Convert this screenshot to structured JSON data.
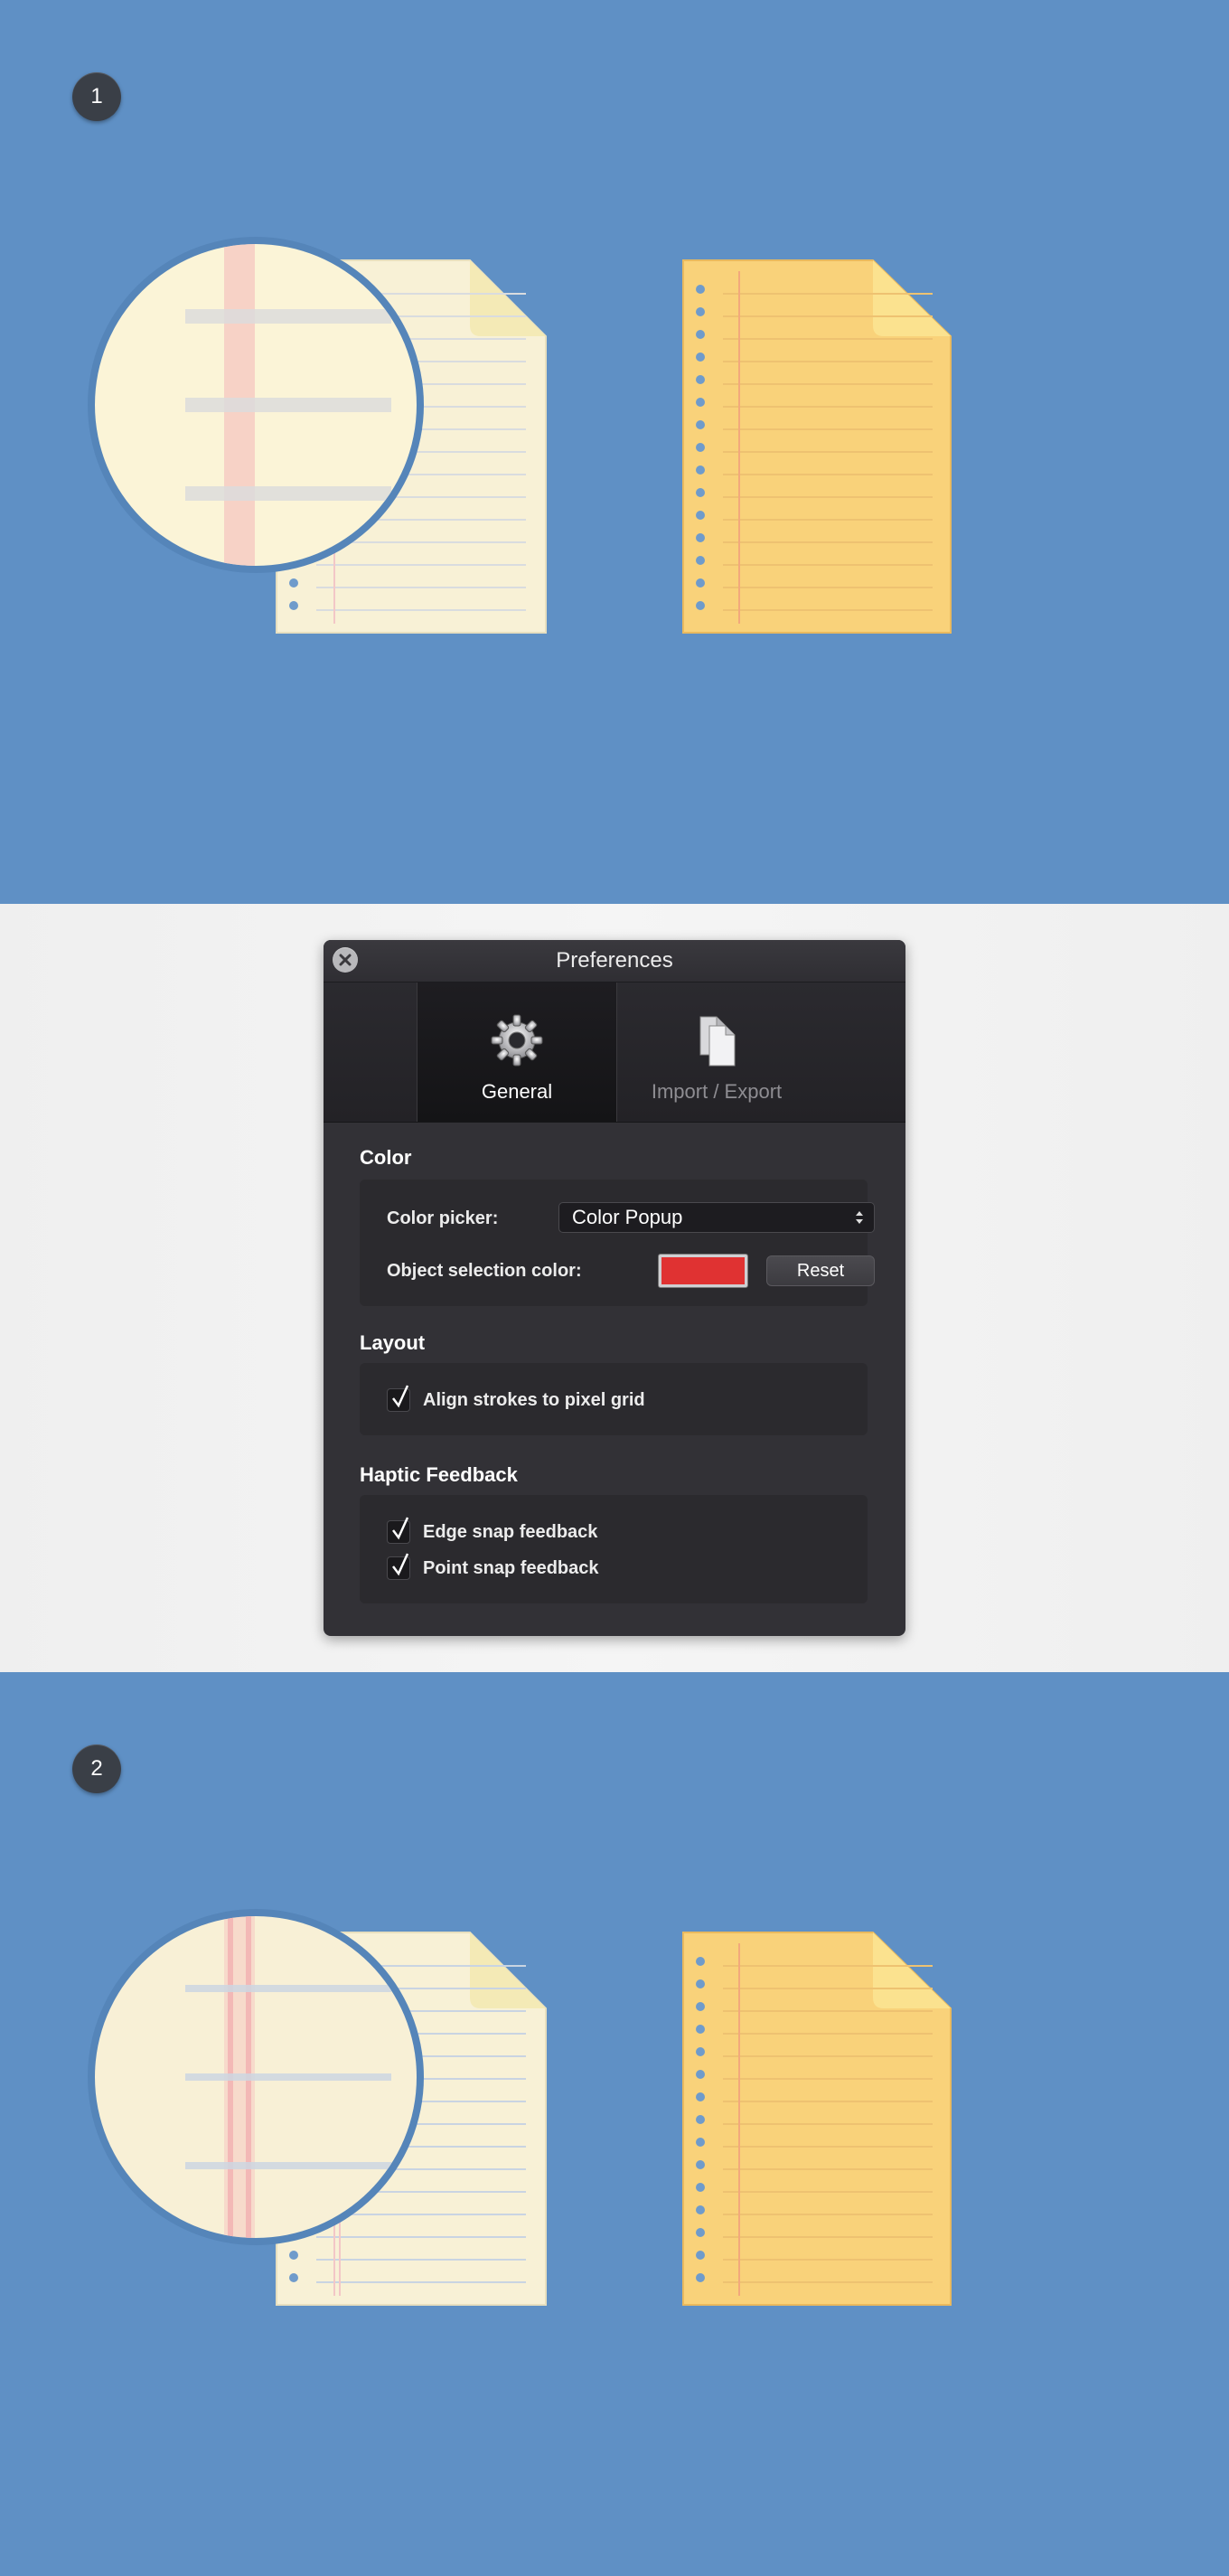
{
  "steps": [
    "1",
    "2"
  ],
  "dialog": {
    "title": "Preferences",
    "tabs": [
      {
        "label": "General",
        "icon": "gear-icon",
        "selected": true
      },
      {
        "label": "Import / Export",
        "icon": "documents-icon",
        "selected": false
      }
    ],
    "sections": {
      "color": {
        "title": "Color",
        "color_picker_label": "Color picker:",
        "color_picker_value": "Color Popup",
        "selection_color_label": "Object selection color:",
        "selection_color": "#e03232",
        "reset_label": "Reset"
      },
      "layout": {
        "title": "Layout",
        "align_strokes_label": "Align strokes to pixel grid",
        "align_strokes_checked": true
      },
      "haptic": {
        "title": "Haptic Feedback",
        "edge_snap_label": "Edge snap feedback",
        "edge_snap_checked": true,
        "point_snap_label": "Point snap feedback",
        "point_snap_checked": true
      }
    }
  },
  "colors": {
    "background_blue": "#5f90c5",
    "paper_cream": "#f8f1d6",
    "paper_yellow": "#f9d27a",
    "dialog_bg": "#323136"
  }
}
